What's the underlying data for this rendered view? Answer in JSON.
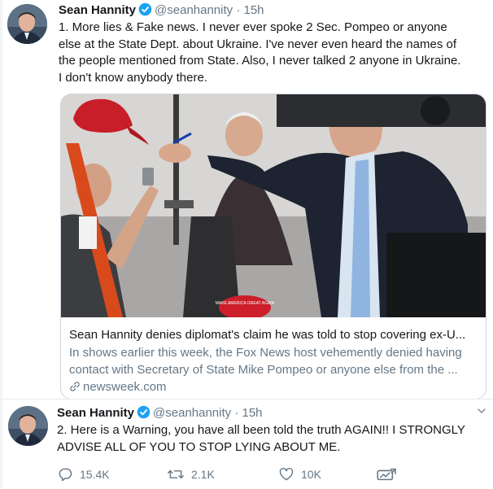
{
  "tweets": [
    {
      "author": {
        "name": "Sean Hannity",
        "handle": "@seanhannity",
        "separator": "·",
        "time": "15h"
      },
      "text": "1. More lies & Fake news. I never ever spoke 2 Sec. Pompeo or anyone else at the State Dept. about Ukraine. I've never even heard the names of the people mentioned from State. Also, I never talked 2 anyone in Ukraine. I don't know anybody there.",
      "card": {
        "title": "Sean Hannity denies diplomat's claim he was told to stop covering ex-U...",
        "description": "In shows earlier this week, the Fox News host vehemently denied having contact with Secretary of State Mike Pompeo or anyone else from the ...",
        "domain": "newsweek.com",
        "image_icon": "photo-man-pointing-pen",
        "hat_text": "MAKE AMERICA GREAT AGAIN"
      }
    },
    {
      "author": {
        "name": "Sean Hannity",
        "handle": "@seanhannity",
        "separator": "·",
        "time": "15h"
      },
      "text": "2. Here is a Warning, you have all been told the truth AGAIN!! I STRONGLY ADVISE ALL OF YOU TO STOP LYING ABOUT ME.",
      "actions": {
        "reply_count": "15.4K",
        "retweet_count": "2.1K",
        "like_count": "10K"
      }
    }
  ],
  "colors": {
    "verified": "#1da1f2",
    "secondary_text": "#657786",
    "border": "#ccd6dd"
  },
  "icons": [
    "verified-badge-icon",
    "link-icon",
    "reply-icon",
    "retweet-icon",
    "like-icon",
    "analytics-icon",
    "caret-down-icon"
  ]
}
